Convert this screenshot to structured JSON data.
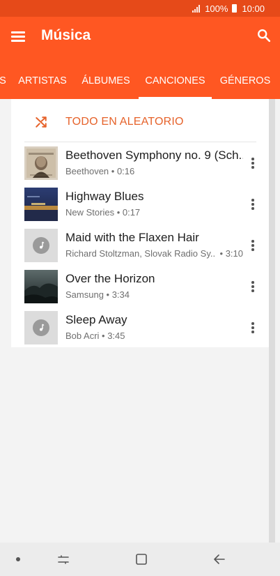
{
  "status_bar": {
    "battery": "100%",
    "time": "10:00"
  },
  "app_bar": {
    "title": "Música",
    "menu_icon": "menu-icon",
    "search_icon": "search-icon"
  },
  "tabs": [
    {
      "label": "S",
      "active": false
    },
    {
      "label": "ARTISTAS",
      "active": false
    },
    {
      "label": "ÁLBUMES",
      "active": false
    },
    {
      "label": "CANCIONES",
      "active": true
    },
    {
      "label": "GÉNEROS",
      "active": false
    }
  ],
  "shuffle": {
    "label": "TODO EN ALEATORIO",
    "icon": "shuffle-icon"
  },
  "songs": [
    {
      "title": "Beethoven Symphony no. 9 (Sch..",
      "artist": "Beethoven",
      "duration": "0:16",
      "thumb": "beethoven-art"
    },
    {
      "title": "Highway Blues",
      "artist": "New Stories",
      "duration": "0:17",
      "thumb": "highway-art"
    },
    {
      "title": "Maid with the Flaxen Hair",
      "artist": "Richard Stoltzman, Slovak Radio Sy..",
      "duration": "3:10",
      "thumb": "music-note-icon"
    },
    {
      "title": "Over the Horizon",
      "artist": "Samsung",
      "duration": "3:34",
      "thumb": "horizon-art"
    },
    {
      "title": "Sleep Away",
      "artist": "Bob Acri",
      "duration": "3:45",
      "thumb": "music-note-icon"
    }
  ],
  "colors": {
    "accent": "#ff5722",
    "status_bar": "#e64a19",
    "shuffle_text": "#e6622a"
  },
  "nav_bar": {
    "icons": [
      "dot-icon",
      "recents-icon",
      "home-icon",
      "back-icon"
    ]
  }
}
